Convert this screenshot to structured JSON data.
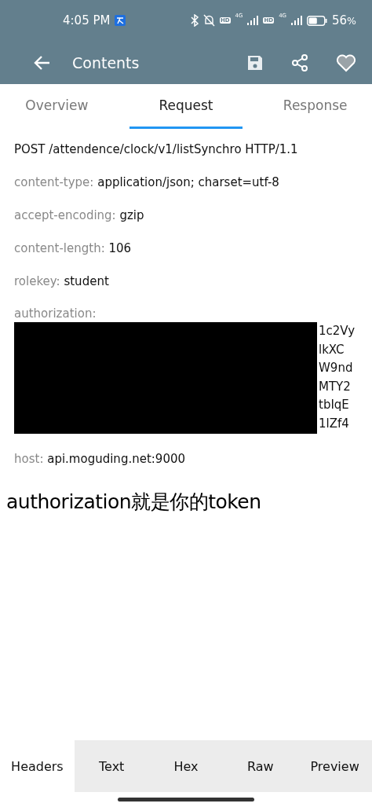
{
  "status_bar": {
    "time": "4:05 PM",
    "sims": [
      {
        "hd": "HD",
        "network": "4G"
      },
      {
        "hd": "HD",
        "network": "4G"
      }
    ],
    "battery": {
      "level": 0.56,
      "percent": "56",
      "unit": "%"
    }
  },
  "app_bar": {
    "title": "Contents"
  },
  "tabs": [
    {
      "label": "Overview",
      "selected": false
    },
    {
      "label": "Request",
      "selected": true
    },
    {
      "label": "Response",
      "selected": false
    }
  ],
  "request_line": "POST /attendence/clock/v1/listSynchro HTTP/1.1",
  "headers": [
    {
      "kind": "plain",
      "key": "content-type:",
      "value": "application/json; charset=utf-8"
    },
    {
      "kind": "plain",
      "key": "accept-encoding:",
      "value": "gzip"
    },
    {
      "kind": "plain",
      "key": "content-length:",
      "value": "106"
    },
    {
      "kind": "plain",
      "key": "rolekey:",
      "value": "student"
    },
    {
      "kind": "redacted",
      "key": "authorization:",
      "fragments": [
        "1c2Vy",
        "lkXC",
        "W9nd",
        "MTY2",
        "tbIqE",
        "1lZf4"
      ]
    },
    {
      "kind": "plain",
      "key": "host:",
      "value": "api.moguding.net:9000"
    }
  ],
  "caption": "authorization就是你的token",
  "bottom_tabs": [
    {
      "label": "Headers",
      "selected": true
    },
    {
      "label": "Text",
      "selected": false
    },
    {
      "label": "Hex",
      "selected": false
    },
    {
      "label": "Raw",
      "selected": false
    },
    {
      "label": "Preview",
      "selected": false
    }
  ]
}
